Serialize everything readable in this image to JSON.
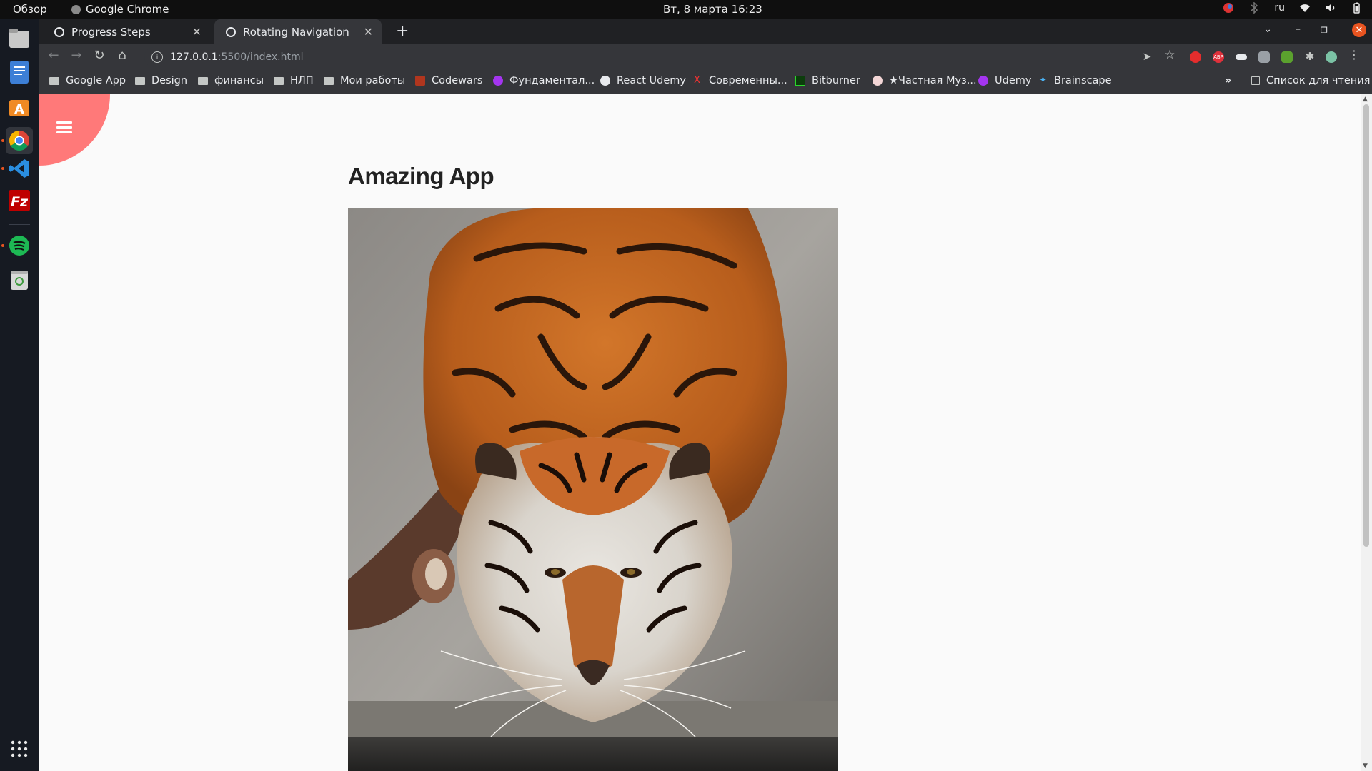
{
  "system": {
    "activities_label": "Обзор",
    "app_name": "Google Chrome",
    "clock": "Вт, 8 марта  16:23",
    "keyboard_layout": "ru"
  },
  "browser": {
    "tabs": [
      {
        "title": "Progress Steps",
        "active": false
      },
      {
        "title": "Rotating Navigation",
        "active": true
      }
    ],
    "url_host": "127.0.0.1",
    "url_path": ":5500/index.html",
    "bookmarks": [
      {
        "label": "Google App",
        "icon": "folder-icon"
      },
      {
        "label": "Design",
        "icon": "folder-icon"
      },
      {
        "label": "финансы",
        "icon": "folder-icon"
      },
      {
        "label": "НЛП",
        "icon": "folder-icon"
      },
      {
        "label": "Мои работы",
        "icon": "folder-icon"
      },
      {
        "label": "Codewars",
        "icon": "codewars-icon"
      },
      {
        "label": "Фундаментал...",
        "icon": "udemy-icon"
      },
      {
        "label": "React Udemy",
        "icon": "globe-icon"
      },
      {
        "label": "Современны...",
        "icon": "yandex-icon"
      },
      {
        "label": "Bitburner",
        "icon": "bitburner-icon"
      },
      {
        "label": "★Частная Муз...",
        "icon": "music-icon"
      },
      {
        "label": "Udemy",
        "icon": "udemy-icon"
      },
      {
        "label": "Brainscape",
        "icon": "brainscape-icon"
      }
    ],
    "more_bookmarks": "»",
    "reading_list": "Список для чтения"
  },
  "page": {
    "title": "Amazing App",
    "menu_circle_color": "#ff7979",
    "hero_image": "tiger drinking water photo"
  },
  "colors": {
    "accent": "#ff7979",
    "ubuntu_orange": "#e95420"
  }
}
